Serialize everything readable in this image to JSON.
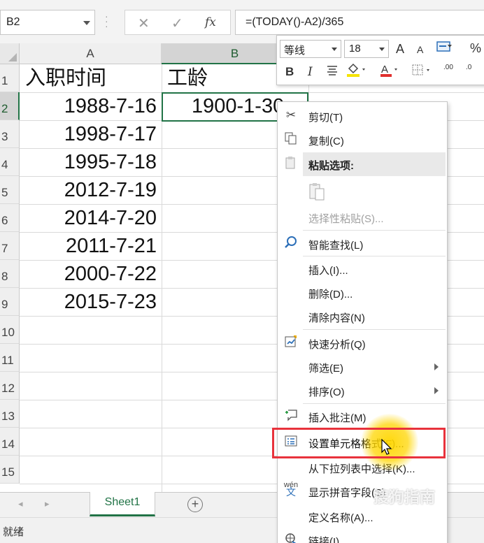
{
  "formula_bar": {
    "name_box": "B2",
    "cancel_icon": "✕",
    "enter_icon": "✓",
    "fx_label": "fx",
    "formula": "=(TODAY()-A2)/365"
  },
  "grid": {
    "columns": [
      {
        "label": "A",
        "selected": false
      },
      {
        "label": "B",
        "selected": true
      }
    ],
    "rows": [
      "1",
      "2",
      "3",
      "4",
      "5",
      "6",
      "7",
      "8",
      "9",
      "10",
      "11",
      "12",
      "13",
      "14",
      "15"
    ],
    "header_a": "入职时间",
    "header_b": "工龄",
    "dates": [
      "1988-7-16",
      "1998-7-17",
      "1995-7-18",
      "2012-7-19",
      "2014-7-20",
      "2011-7-21",
      "2000-7-22",
      "2015-7-23"
    ],
    "b2_value": "1900-1-30"
  },
  "sheet_tabs": {
    "active_tab": "Sheet1",
    "add_icon": "+"
  },
  "status_bar": {
    "status": "就绪"
  },
  "mini_toolbar": {
    "font_name": "等线",
    "font_size": "18",
    "grow_font": "A",
    "shrink_font": "A",
    "bold": "B",
    "italic": "I",
    "percent": "%",
    "inc_decimal": ".00",
    "dec_decimal": ".0"
  },
  "context_menu": {
    "items": [
      {
        "label": "剪切(T)",
        "icon": "scissors-icon"
      },
      {
        "label": "复制(C)",
        "icon": "copy-icon"
      },
      {
        "label": "粘贴选项:",
        "icon": "paste-icon"
      },
      {
        "label": "选择性粘贴(S)...",
        "icon": ""
      },
      {
        "label": "智能查找(L)",
        "icon": "smart-lookup-icon"
      },
      {
        "label": "插入(I)...",
        "icon": ""
      },
      {
        "label": "删除(D)...",
        "icon": ""
      },
      {
        "label": "清除内容(N)",
        "icon": ""
      },
      {
        "label": "快速分析(Q)",
        "icon": "quick-analysis-icon"
      },
      {
        "label": "筛选(E)",
        "icon": ""
      },
      {
        "label": "排序(O)",
        "icon": ""
      },
      {
        "label": "插入批注(M)",
        "icon": "comment-icon"
      },
      {
        "label": "设置单元格格式(F)...",
        "icon": "format-cells-icon"
      },
      {
        "label": "从下拉列表中选择(K)...",
        "icon": ""
      },
      {
        "label": "显示拼音字段(S)",
        "icon": "phonetic-icon"
      },
      {
        "label": "定义名称(A)...",
        "icon": ""
      },
      {
        "label": "链接(I)",
        "icon": "link-icon"
      }
    ]
  },
  "watermark": "搜狗指南",
  "colors": {
    "accent": "#217346",
    "highlight_frame": "#e8323c",
    "cursor_glow": "#ffd600"
  }
}
